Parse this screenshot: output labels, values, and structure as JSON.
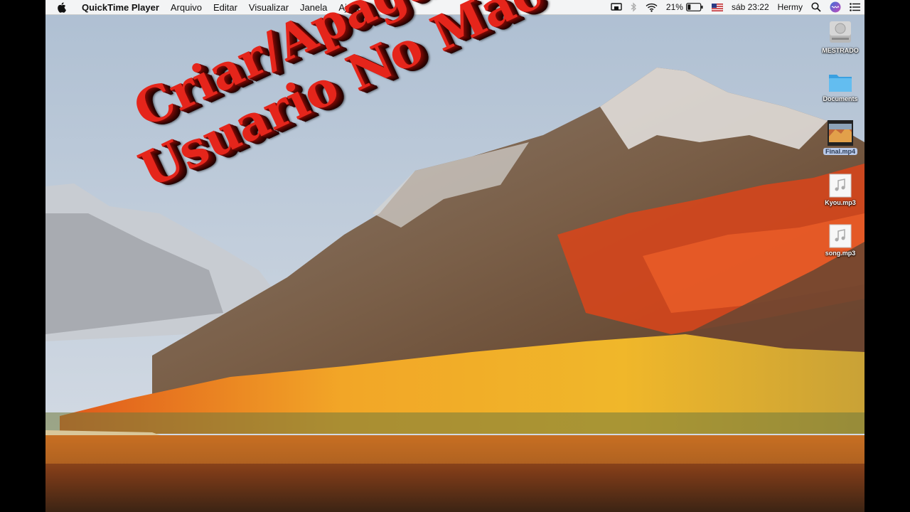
{
  "menubar": {
    "app_name": "QuickTime Player",
    "items": [
      "Arquivo",
      "Editar",
      "Visualizar",
      "Janela",
      "Ajuda"
    ],
    "battery": "21%",
    "clock": "sáb 23:22",
    "user": "Hermy"
  },
  "overlay": {
    "line1": "Criar/Apagar",
    "line2": "Usuario No Mac"
  },
  "desktop_icons": [
    {
      "label": "MESTRADO",
      "icon": "hard-drive-icon"
    },
    {
      "label": "Documents",
      "icon": "folder-icon"
    },
    {
      "label": "Final.mp4",
      "icon": "video-file-icon"
    },
    {
      "label": "Kyou.mp3",
      "icon": "audio-file-icon"
    },
    {
      "label": "song.mp3",
      "icon": "audio-file-icon"
    }
  ],
  "colors": {
    "overlay_text": "#e5251b",
    "menubar_bg": "#f6f6f6",
    "folder_blue": "#4fb3ec"
  }
}
